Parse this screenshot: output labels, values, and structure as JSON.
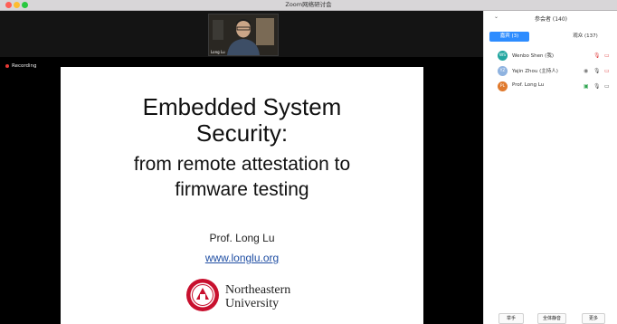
{
  "window": {
    "title": "Zoom网络研讨会"
  },
  "recording": {
    "label": "Recording"
  },
  "video": {
    "name_tag": "Long Lu"
  },
  "slide": {
    "title_line1": "Embedded System",
    "title_line2": "Security:",
    "subtitle_line1": "from remote attestation to",
    "subtitle_line2": "firmware testing",
    "author": "Prof. Long Lu",
    "url": "www.longlu.org",
    "logo_line1": "Northeastern",
    "logo_line2": "University"
  },
  "panel": {
    "title": "参会者 (140)",
    "tabs": [
      {
        "label": "嘉宾 (3)"
      },
      {
        "label": "观众 (137)"
      }
    ],
    "participants": [
      {
        "initials": "WS",
        "name": "Wenbo Shen (我)",
        "color": "#22a6a0"
      },
      {
        "initials": "YZ",
        "name": "Yajin Zhou (主持人)",
        "color": "#8fb3e0"
      },
      {
        "initials": "PL",
        "name": "Prof. Long Lu",
        "color": "#e07a2e"
      }
    ],
    "footer": {
      "raise_label": "举手",
      "mute_all_label": "全体静音",
      "more_label": "更多"
    }
  }
}
